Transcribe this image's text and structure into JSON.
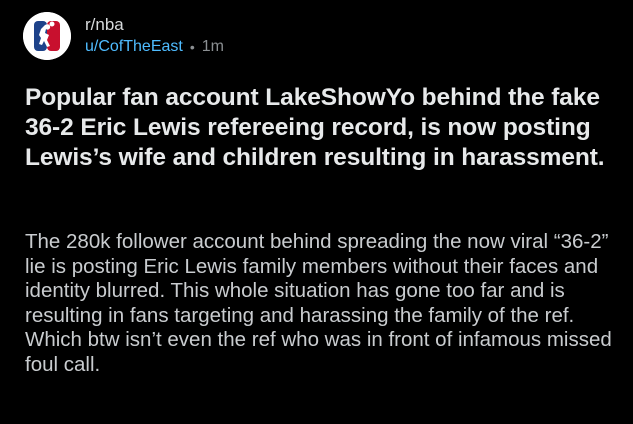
{
  "post": {
    "subreddit": "r/nba",
    "username": "u/CofTheEast",
    "separator": "•",
    "time": "1m",
    "avatar_icon": "nba-logo-icon",
    "title": "Popular fan account LakeShowYo behind the fake 36-2 Eric Lewis refereeing record, is now posting Lewis’s wife and children resulting in harassment.",
    "body": "The 280k follower account behind spreading the now viral “36-2” lie is posting Eric Lewis family members without their faces and identity blurred. This whole situation has gone too far and is resulting in fans targeting and harassing the family of the ref. Which btw isn’t even the ref who was in front of infamous missed foul call."
  },
  "colors": {
    "background": "#000000",
    "username": "#4fbcff",
    "muted": "#8b8f92",
    "title": "#e7e9ea",
    "body": "#c9cccf",
    "logo_blue": "#1d428a",
    "logo_red": "#c8102e"
  }
}
